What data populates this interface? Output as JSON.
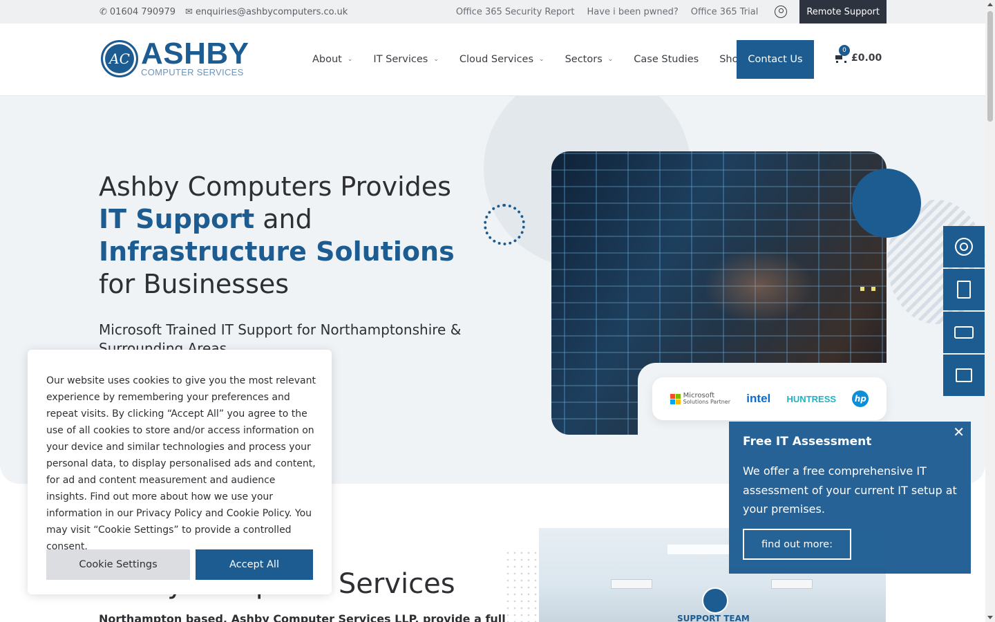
{
  "topbar": {
    "phone": "01604 790979",
    "email": "enquiries@ashbycomputers.co.uk",
    "links": [
      "Office 365 Security Report",
      "Have i been pwned?",
      "Office 365 Trial"
    ],
    "remote_support": "Remote Support"
  },
  "header": {
    "logo_main": "ASHBY",
    "logo_sub": "COMPUTER SERVICES",
    "logo_mark": "AC",
    "nav": [
      {
        "label": "About",
        "dropdown": true
      },
      {
        "label": "IT Services",
        "dropdown": true
      },
      {
        "label": "Cloud Services",
        "dropdown": true
      },
      {
        "label": "Sectors",
        "dropdown": true
      },
      {
        "label": "Case Studies",
        "dropdown": false
      },
      {
        "label": "Shop",
        "dropdown": false
      }
    ],
    "contact_button": "Contact Us",
    "cart_count": "0",
    "cart_total": "£0.00"
  },
  "hero": {
    "title_part1": "Ashby Computers Provides ",
    "title_highlight1": "IT Support",
    "title_part2": " and ",
    "title_highlight2": "Infrastructure Solutions",
    "title_part3": " for Businesses",
    "subtitle": "Microsoft Trained IT Support for Northamptonshire & Surrounding Areas",
    "partners": {
      "microsoft_line1": "Microsoft",
      "microsoft_line2": "Solutions Partner",
      "intel": "intel",
      "huntress": "HUNTRESS",
      "hp": "hp"
    }
  },
  "lower": {
    "heading": "Ashby Computer Services",
    "paragraph": "Northampton based, Ashby Computer Services LLP, provide a full",
    "team_sign": "SUPPORT TEAM"
  },
  "cookie": {
    "text": "Our website uses cookies to give you the most relevant experience by remembering your preferences and repeat visits. By clicking “Accept All” you agree to the use of all cookies to store and/or access information on your device and similar technologies and process your personal data, to display personalised ads and content, for ad and content measurement and audience insights. Find out more about how we use your information in our Privacy Policy and Cookie Policy. You may visit “Cookie Settings” to provide a controlled consent.",
    "settings_label": "Cookie Settings",
    "accept_label": "Accept All"
  },
  "assessment": {
    "title": "Free IT Assessment",
    "body": "We offer a free comprehensive IT assessment of your current IT setup at your premises.",
    "button": "find out more:",
    "close": "✕"
  },
  "side_widgets": [
    "support-icon",
    "checklist-icon",
    "chat-icon",
    "remote-desktop-icon"
  ],
  "colors": {
    "brand": "#1d5c91",
    "dark": "#2e3340",
    "hero_bg": "#eff3f6"
  }
}
